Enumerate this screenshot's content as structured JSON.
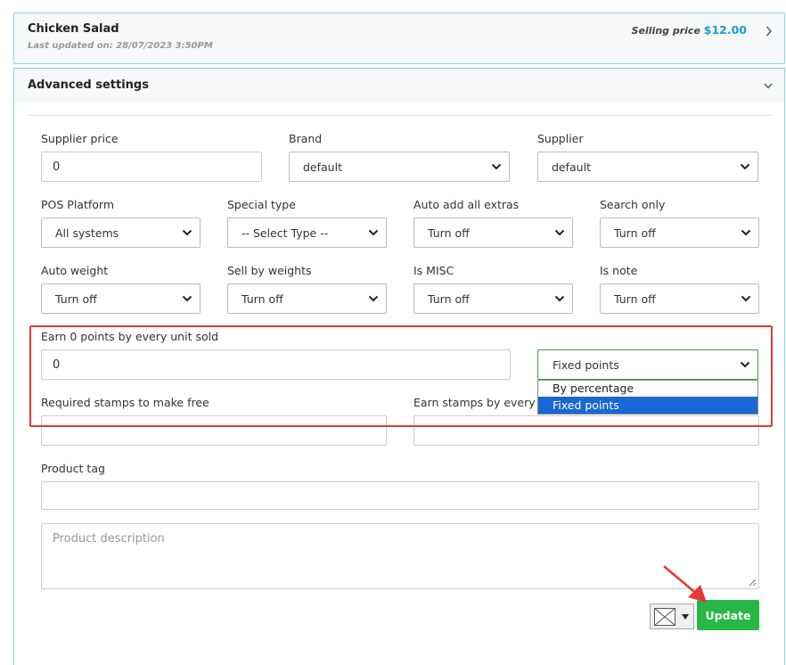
{
  "product": {
    "name": "Chicken Salad",
    "last_updated": "Last updated on: 28/07/2023 3:50PM",
    "price_label": "Selling price",
    "price": "$12.00"
  },
  "advanced": {
    "title": "Advanced settings"
  },
  "fields": {
    "supplier_price": {
      "label": "Supplier price",
      "value": "0"
    },
    "brand": {
      "label": "Brand",
      "value": "default"
    },
    "supplier": {
      "label": "Supplier",
      "value": "default"
    },
    "pos_platform": {
      "label": "POS Platform",
      "value": "All systems"
    },
    "special_type": {
      "label": "Special type",
      "value": "-- Select Type --"
    },
    "auto_add_extras": {
      "label": "Auto add all extras",
      "value": "Turn off"
    },
    "search_only": {
      "label": "Search only",
      "value": "Turn off"
    },
    "auto_weight": {
      "label": "Auto weight",
      "value": "Turn off"
    },
    "sell_by_weights": {
      "label": "Sell by weights",
      "value": "Turn off"
    },
    "is_misc": {
      "label": "Is MISC",
      "value": "Turn off"
    },
    "is_note": {
      "label": "Is note",
      "value": "Turn off"
    },
    "earn_points": {
      "label": "Earn 0 points by every unit sold",
      "value": "0"
    },
    "points_type": {
      "value": "Fixed points",
      "options": [
        "By percentage",
        "Fixed points"
      ]
    },
    "required_stamps": {
      "label": "Required stamps to make free",
      "value": ""
    },
    "earn_stamps": {
      "label": "Earn stamps by every u",
      "value": ""
    },
    "product_tag": {
      "label": "Product tag",
      "value": ""
    },
    "product_description": {
      "placeholder": "Product description"
    }
  },
  "actions": {
    "update": "Update"
  },
  "colors": {
    "accent": "#17a2c8",
    "update": "#28b744",
    "highlight": "#e53935",
    "dropdown_selected": "#1967d2"
  }
}
